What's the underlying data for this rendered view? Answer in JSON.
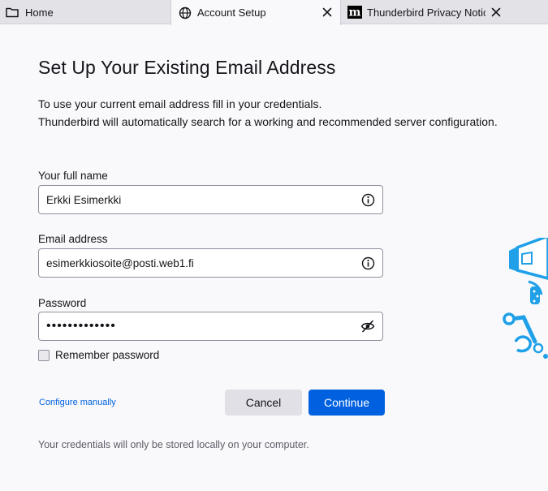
{
  "tabs": [
    {
      "label": "Home",
      "icon": "folder-icon"
    },
    {
      "label": "Account Setup",
      "icon": "globe-icon",
      "close_icon": "close-icon"
    },
    {
      "label": "Thunderbird Privacy Notice",
      "icon": "mozilla-m-icon",
      "close_icon": "close-icon"
    }
  ],
  "page": {
    "title": "Set Up Your Existing Email Address",
    "intro_line1": "To use your current email address fill in your credentials.",
    "intro_line2": "Thunderbird will automatically search for a working and recommended server configuration."
  },
  "form": {
    "fullname": {
      "label": "Your full name",
      "value": "Erkki Esimerkki",
      "icon": "info-icon"
    },
    "email": {
      "label": "Email address",
      "value": "esimerkkiosoite@posti.web1.fi",
      "icon": "info-icon"
    },
    "password": {
      "label": "Password",
      "value": "•••••••••••••",
      "icon": "eye-slash-icon"
    },
    "remember": {
      "label": "Remember password",
      "checked": false
    }
  },
  "actions": {
    "configure_manually": "Configure manually",
    "cancel": "Cancel",
    "continue": "Continue"
  },
  "footnote": "Your credentials will only be stored locally on your computer.",
  "colors": {
    "accent": "#0061e0",
    "background": "#f9f9fb",
    "tabbar": "#e3e3e7",
    "illustration": "#1fa0e8"
  }
}
